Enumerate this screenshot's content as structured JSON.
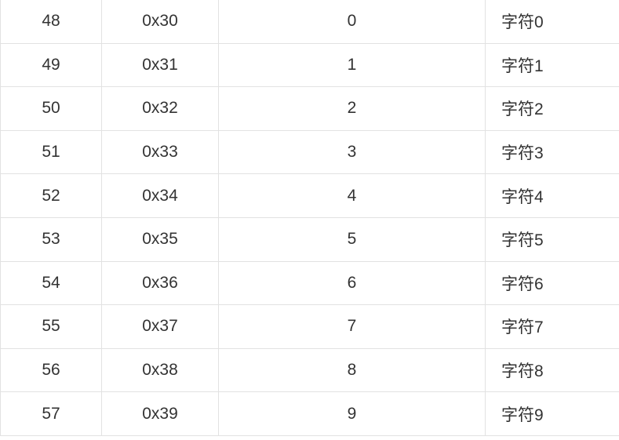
{
  "table": {
    "rows": [
      {
        "dec": "48",
        "hex": "0x30",
        "char": "0",
        "desc": "字符0"
      },
      {
        "dec": "49",
        "hex": "0x31",
        "char": "1",
        "desc": "字符1"
      },
      {
        "dec": "50",
        "hex": "0x32",
        "char": "2",
        "desc": "字符2"
      },
      {
        "dec": "51",
        "hex": "0x33",
        "char": "3",
        "desc": "字符3"
      },
      {
        "dec": "52",
        "hex": "0x34",
        "char": "4",
        "desc": "字符4"
      },
      {
        "dec": "53",
        "hex": "0x35",
        "char": "5",
        "desc": "字符5"
      },
      {
        "dec": "54",
        "hex": "0x36",
        "char": "6",
        "desc": "字符6"
      },
      {
        "dec": "55",
        "hex": "0x37",
        "char": "7",
        "desc": "字符7"
      },
      {
        "dec": "56",
        "hex": "0x38",
        "char": "8",
        "desc": "字符8"
      },
      {
        "dec": "57",
        "hex": "0x39",
        "char": "9",
        "desc": "字符9"
      }
    ]
  },
  "colors": {
    "text": "#333333",
    "border": "#e2e2e2",
    "background": "#ffffff"
  }
}
